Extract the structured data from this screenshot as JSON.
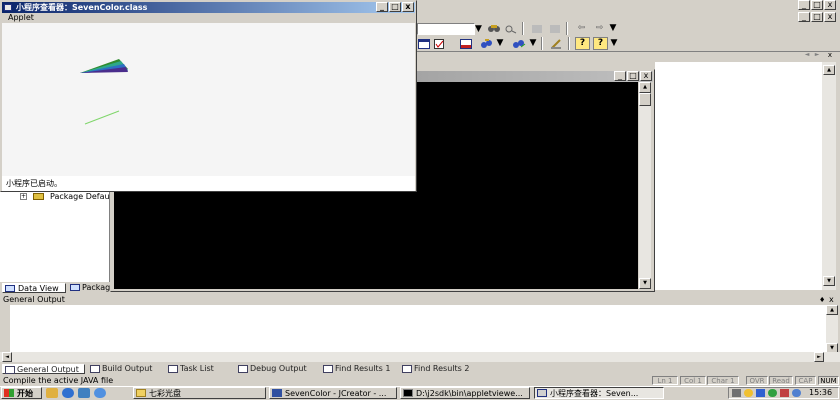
{
  "applet": {
    "title": "小程序查看器：SevenColor.class",
    "menu_label": "Applet",
    "status_text": "小程序已启动。",
    "drawing": [
      {
        "kind": "wedge",
        "colors": [
          "#2e8b2e",
          "#2da88a",
          "#2d6fc4",
          "#4a2d8c"
        ]
      },
      {
        "kind": "line",
        "color": "#7fd66a"
      }
    ]
  },
  "tree": {
    "item_label": "Package Defau",
    "expander": "+",
    "tabs": [
      {
        "label": "Data View"
      },
      {
        "label": "Packag"
      }
    ]
  },
  "output": {
    "panel_title": "General Output",
    "tabs": [
      {
        "label": "General Output"
      },
      {
        "label": "Build Output"
      },
      {
        "label": "Task List"
      },
      {
        "label": "Debug Output"
      },
      {
        "label": "Find Results 1"
      },
      {
        "label": "Find Results 2"
      }
    ]
  },
  "status": {
    "message": "Compile the active JAVA file",
    "ln": "Ln 1",
    "col": "Col 1",
    "char": "Char 1",
    "ovr": "OVR",
    "read": "Read",
    "cap": "CAP",
    "num": "NUM"
  },
  "taskbar": {
    "start_label": "开始",
    "tasks": [
      {
        "label": "七彩光盘"
      },
      {
        "label": "SevenColor - JCreator - ..."
      },
      {
        "label": "D:\\j2sdk\\bin\\appletviewe..."
      },
      {
        "label": "小程序查看器：Seven..."
      }
    ],
    "clock": "15:36"
  },
  "icons": {
    "minimize": "_",
    "maximize": "□",
    "close": "x",
    "arrow_up": "▲",
    "arrow_down": "▼",
    "arrow_left": "◄",
    "arrow_right": "►",
    "back": "⇦",
    "forward": "⇨",
    "help": "?"
  }
}
